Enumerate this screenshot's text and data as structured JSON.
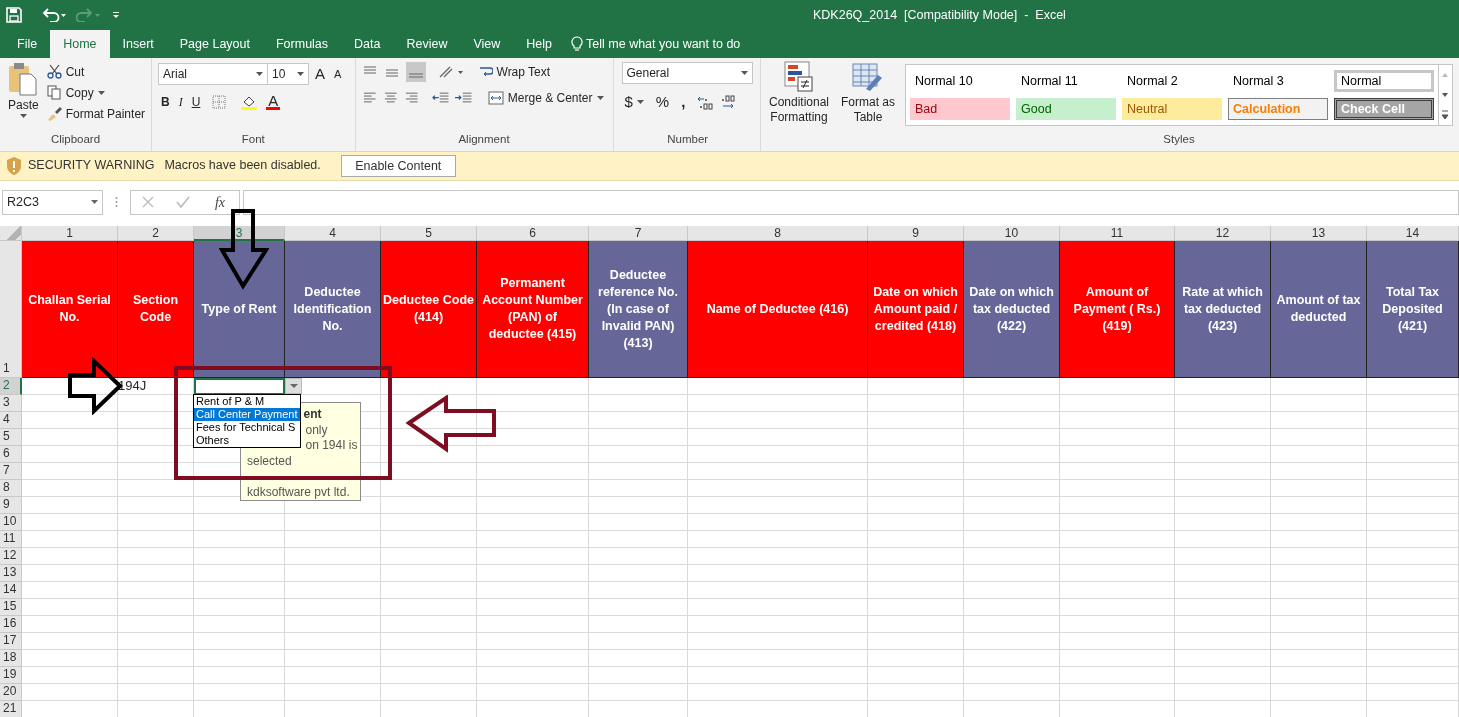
{
  "window": {
    "title": "KDK26Q_2014  [Compatibility Mode]  -  Excel"
  },
  "ribbon_tabs": [
    {
      "label": "File",
      "selected": false
    },
    {
      "label": "Home",
      "selected": true
    },
    {
      "label": "Insert",
      "selected": false
    },
    {
      "label": "Page Layout",
      "selected": false
    },
    {
      "label": "Formulas",
      "selected": false
    },
    {
      "label": "Data",
      "selected": false
    },
    {
      "label": "Review",
      "selected": false
    },
    {
      "label": "View",
      "selected": false
    },
    {
      "label": "Help",
      "selected": false
    }
  ],
  "tell_me": "Tell me what you want to do",
  "clipboard": {
    "paste": "Paste",
    "cut": "Cut",
    "copy": "Copy",
    "format_painter": "Format Painter",
    "group": "Clipboard"
  },
  "font": {
    "name": "Arial",
    "size": "10",
    "grow": "A",
    "shrink": "A",
    "bold": "B",
    "italic": "I",
    "underline": "U",
    "font_color_glyph": "A",
    "group": "Font"
  },
  "alignment": {
    "wrap_text": "Wrap Text",
    "merge_center": "Merge & Center",
    "group": "Alignment"
  },
  "number": {
    "format": "General",
    "currency": "$",
    "percent": "%",
    "comma": ",",
    "group": "Number"
  },
  "conditional_formatting": "Conditional Formatting",
  "format_as_table": "Format as Table",
  "styles": {
    "group": "Styles",
    "items": [
      {
        "label": "Normal 10",
        "kind": "normal",
        "selected": false
      },
      {
        "label": "Normal 11",
        "kind": "normal",
        "selected": false
      },
      {
        "label": "Normal 2",
        "kind": "normal",
        "selected": false
      },
      {
        "label": "Normal 3",
        "kind": "normal",
        "selected": false
      },
      {
        "label": "Normal",
        "kind": "normal",
        "selected": true
      },
      {
        "label": "Bad",
        "kind": "bad",
        "selected": false
      },
      {
        "label": "Good",
        "kind": "good",
        "selected": false
      },
      {
        "label": "Neutral",
        "kind": "neutral",
        "selected": false
      },
      {
        "label": "Calculation",
        "kind": "calculation",
        "selected": false
      },
      {
        "label": "Check Cell",
        "kind": "check",
        "selected": false
      }
    ]
  },
  "security_bar": {
    "title": "SECURITY WARNING",
    "message": "Macros have been disabled.",
    "button": "Enable Content"
  },
  "formula_bar": {
    "name_box": "R2C3",
    "function_label": "fx"
  },
  "sheet": {
    "columns": [
      {
        "label": "1",
        "selected": false,
        "header": "Challan Serial No.",
        "color": "#ff0000"
      },
      {
        "label": "2",
        "selected": false,
        "header": "Section Code",
        "color": "#ff0000"
      },
      {
        "label": "3",
        "selected": true,
        "header": "Type of Rent",
        "color": "#666699"
      },
      {
        "label": "4",
        "selected": false,
        "header": "Deductee Identification No.",
        "color": "#666699"
      },
      {
        "label": "5",
        "selected": false,
        "header": "Deductee Code (414)",
        "color": "#ff0000"
      },
      {
        "label": "6",
        "selected": false,
        "header": "Permanent Account Number (PAN) of deductee (415)",
        "color": "#ff0000"
      },
      {
        "label": "7",
        "selected": false,
        "header": "Deductee reference No. (In case of Invalid PAN) (413)",
        "color": "#666699"
      },
      {
        "label": "8",
        "selected": false,
        "header": "Name of Deductee (416)",
        "color": "#ff0000"
      },
      {
        "label": "9",
        "selected": false,
        "header": "Date on which Amount paid / credited (418)",
        "color": "#ff0000"
      },
      {
        "label": "10",
        "selected": false,
        "header": "Date on which tax deducted (422)",
        "color": "#666699"
      },
      {
        "label": "11",
        "selected": false,
        "header": "Amount of Payment ( Rs.) (419)",
        "color": "#ff0000"
      },
      {
        "label": "12",
        "selected": false,
        "header": "Rate at which tax deducted (423)",
        "color": "#666699"
      },
      {
        "label": "13",
        "selected": false,
        "header": "Amount of tax deducted",
        "color": "#666699"
      },
      {
        "label": "14",
        "selected": false,
        "header": "Total Tax Deposited (421)",
        "color": "#666699"
      }
    ],
    "rows": [
      {
        "label": "1",
        "selected": false
      },
      {
        "label": "2",
        "selected": true,
        "column_2": "194J"
      },
      {
        "label": "3",
        "selected": false
      },
      {
        "label": "4",
        "selected": false
      },
      {
        "label": "5",
        "selected": false
      },
      {
        "label": "6",
        "selected": false
      },
      {
        "label": "7",
        "selected": false
      },
      {
        "label": "8",
        "selected": false
      },
      {
        "label": "9",
        "selected": false
      },
      {
        "label": "10",
        "selected": false
      },
      {
        "label": "11",
        "selected": false
      },
      {
        "label": "12",
        "selected": false
      },
      {
        "label": "13",
        "selected": false
      },
      {
        "label": "14",
        "selected": false
      },
      {
        "label": "15",
        "selected": false
      },
      {
        "label": "16",
        "selected": false
      },
      {
        "label": "17",
        "selected": false
      },
      {
        "label": "18",
        "selected": false
      },
      {
        "label": "19",
        "selected": false
      },
      {
        "label": "20",
        "selected": false
      },
      {
        "label": "21",
        "selected": false
      }
    ]
  },
  "validation_list": {
    "options": [
      {
        "label": "Rent of P & M",
        "selected": false
      },
      {
        "label": "Call Center Payment",
        "selected": true
      },
      {
        "label": "Fees for Technical S",
        "selected": false
      },
      {
        "label": "Others",
        "selected": false
      }
    ]
  },
  "comment": {
    "lines": [
      {
        "text": "ent",
        "kind": "behind_list_bold"
      },
      {
        "text": "only",
        "kind": "behind_list"
      },
      {
        "text": "on 194I is",
        "kind": "behind_list"
      },
      {
        "text": "selected",
        "kind": "plain"
      },
      {
        "text": "kdksoftware pvt ltd.",
        "kind": "signature"
      }
    ]
  }
}
